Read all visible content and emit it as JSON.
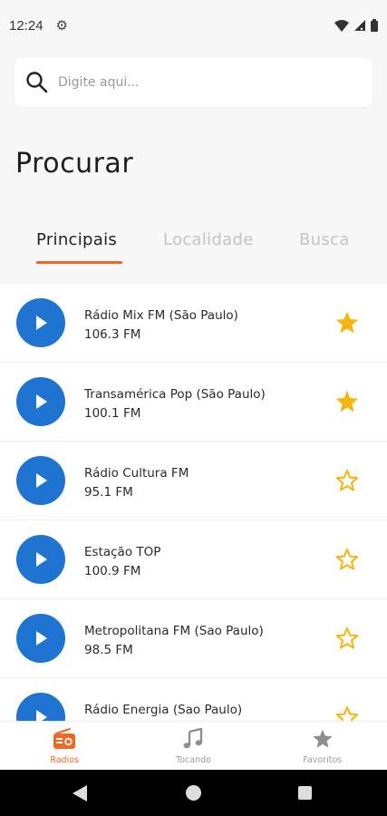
{
  "status_bar": {
    "time": "12:24"
  },
  "search": {
    "placeholder": "Digite aqui..."
  },
  "page_title": "Procurar",
  "tabs": [
    {
      "label": "Principais",
      "active": true
    },
    {
      "label": "Localidade",
      "active": false
    },
    {
      "label": "Busca",
      "active": false
    }
  ],
  "stations": [
    {
      "name": "Rádio Mix FM (São Paulo)",
      "frequency": "106.3 FM",
      "favorite": true
    },
    {
      "name": "Transamérica Pop (São Paulo)",
      "frequency": "100.1 FM",
      "favorite": true
    },
    {
      "name": "Rádio Cultura FM",
      "frequency": "95.1 FM",
      "favorite": false
    },
    {
      "name": "Estação TOP",
      "frequency": "100.9 FM",
      "favorite": false
    },
    {
      "name": "Metropolitana FM (Sao Paulo)",
      "frequency": "98.5 FM",
      "favorite": false
    },
    {
      "name": "Rádio Energia (Sao Paulo)",
      "frequency": "",
      "favorite": false
    }
  ],
  "bottom_nav": [
    {
      "label": "Radios",
      "icon": "radio-icon",
      "active": true
    },
    {
      "label": "Tocando",
      "icon": "music-note-icon",
      "active": false
    },
    {
      "label": "Favoritos",
      "icon": "star-icon",
      "active": false
    }
  ],
  "colors": {
    "accent": "#f26722",
    "play": "#1e74d0",
    "star": "#f5b60f"
  }
}
